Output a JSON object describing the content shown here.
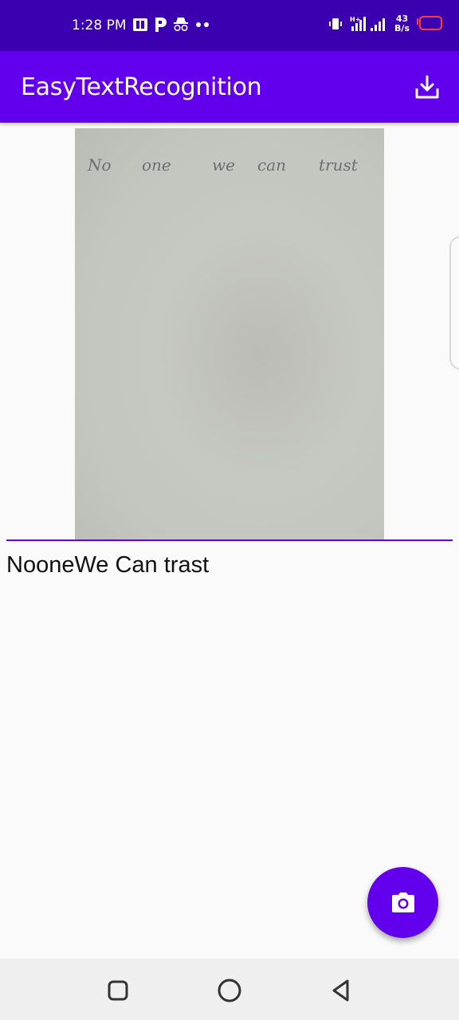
{
  "status_bar": {
    "time": "1:28 PM",
    "net_speed_value": "43",
    "net_speed_unit": "B/s",
    "network_type": "H+"
  },
  "app_bar": {
    "title": "EasyTextRecognition"
  },
  "photo": {
    "words": [
      "No",
      "one",
      "we",
      "can",
      "trust"
    ]
  },
  "result": {
    "text": "NooneWe Can trast"
  },
  "colors": {
    "status_bar": "#3b00b0",
    "app_bar": "#6200ee",
    "accent": "#6200ee",
    "background": "#fafafa",
    "nav_bar": "#efefef"
  },
  "icons": {
    "download": "download-icon",
    "camera": "camera-icon",
    "recents": "recents-icon",
    "home": "home-icon",
    "back": "back-icon"
  }
}
